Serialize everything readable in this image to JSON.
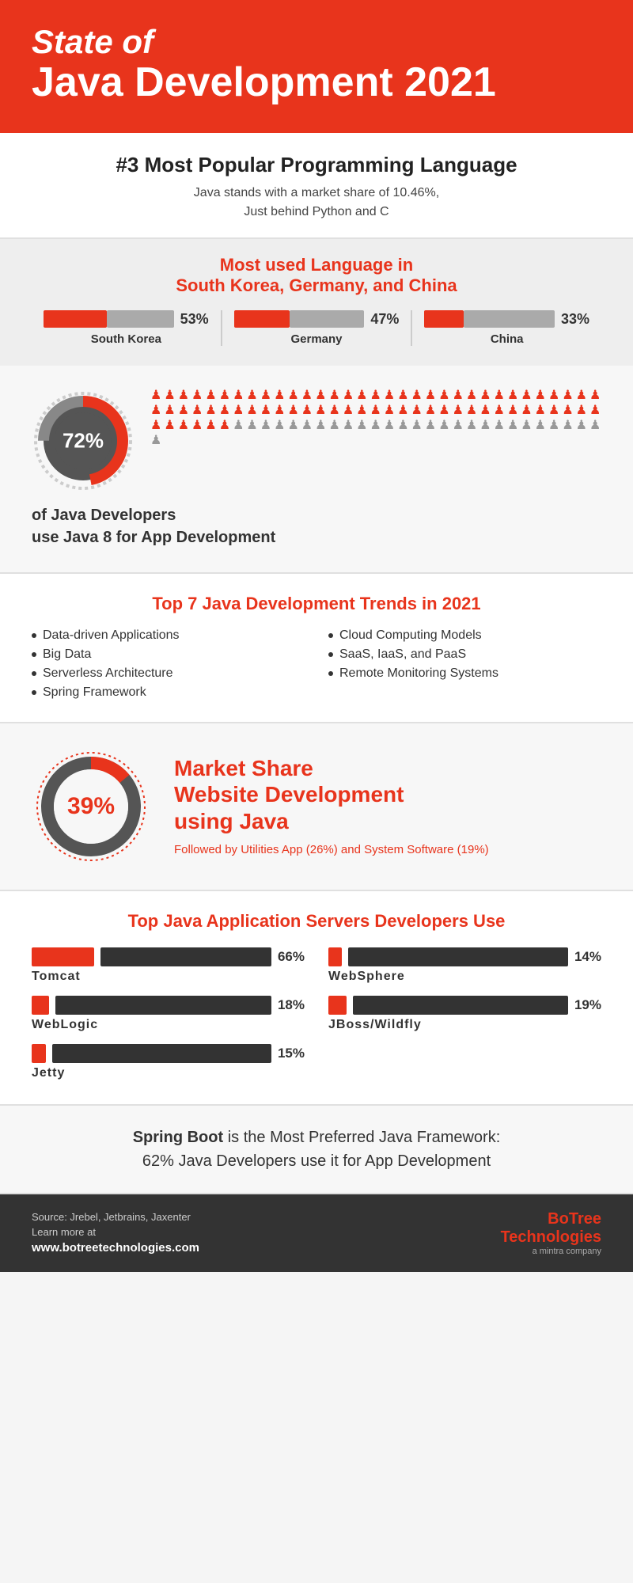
{
  "header": {
    "state_of": "State of",
    "title": "Java Development 2021"
  },
  "popular": {
    "heading": "#3 Most Popular Programming Language",
    "desc1": "Java stands with a market share of 10.46%,",
    "desc2": "Just behind Python and C"
  },
  "language": {
    "heading1": "Most used Language in",
    "heading2": "South Korea, Germany, and China",
    "countries": [
      {
        "name": "South Korea",
        "pct": "53%",
        "fill": 53
      },
      {
        "name": "Germany",
        "pct": "47%",
        "fill": 47
      },
      {
        "name": "China",
        "pct": "33%",
        "fill": 33
      }
    ]
  },
  "java8": {
    "pct": "72%",
    "desc1": "of Java Developers",
    "desc2": "use Java 8 for App Development",
    "orange_people": 72,
    "total_people": 100
  },
  "trends": {
    "heading": "Top 7 Java Development Trends in 2021",
    "items": [
      "Data-driven Applications",
      "Big Data",
      "Serverless Architecture",
      "Spring Framework",
      "Cloud Computing Models",
      "SaaS, IaaS, and PaaS",
      "Remote Monitoring Systems"
    ]
  },
  "market": {
    "pct": "39%",
    "heading1": "Market Share",
    "heading2": "Website Development",
    "heading3": "using",
    "java": "Java",
    "desc": "Followed by Utilities App (26%) and System Software (19%)"
  },
  "servers": {
    "heading": "Top Java Application Servers Developers Use",
    "items": [
      {
        "name": "Tomcat",
        "pct": "66%",
        "fill": 66
      },
      {
        "name": "WebSphere",
        "pct": "14%",
        "fill": 14
      },
      {
        "name": "WebLogic",
        "pct": "18%",
        "fill": 18
      },
      {
        "name": "JBoss/Wildfly",
        "pct": "19%",
        "fill": 19
      },
      {
        "name": "Jetty",
        "pct": "15%",
        "fill": 15
      }
    ]
  },
  "spring": {
    "text1": "Spring Boot",
    "text2": " is the Most Preferred Java Framework:",
    "text3": "62% Java Developers use it for App Development"
  },
  "footer": {
    "source": "Source: Jrebel, Jetbrains, Jaxenter",
    "learn": "Learn more at",
    "url": "www.botreetechnologies.com",
    "logo1": "BoTree",
    "logo2": "Technologies",
    "sub": "a mintra company"
  }
}
